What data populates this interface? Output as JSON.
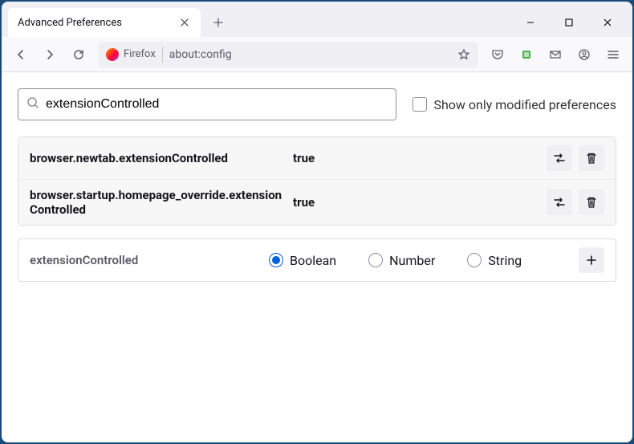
{
  "tab": {
    "title": "Advanced Preferences"
  },
  "addressBar": {
    "identity": "Firefox",
    "url": "about:config"
  },
  "search": {
    "value": "extensionControlled",
    "showModifiedLabel": "Show only modified preferences"
  },
  "prefs": [
    {
      "name": "browser.newtab.extensionControlled",
      "value": "true"
    },
    {
      "name": "browser.startup.homepage_override.extensionControlled",
      "value": "true"
    }
  ],
  "addPref": {
    "name": "extensionControlled",
    "types": {
      "boolean": "Boolean",
      "number": "Number",
      "string": "String"
    }
  }
}
